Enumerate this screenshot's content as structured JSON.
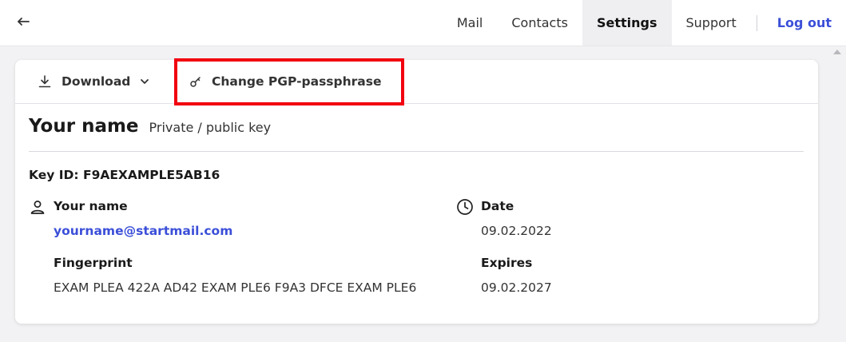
{
  "nav": {
    "back_icon": "arrow-left-icon",
    "items": [
      {
        "label": "Mail"
      },
      {
        "label": "Contacts"
      },
      {
        "label": "Settings",
        "active": true
      },
      {
        "label": "Support"
      }
    ],
    "logout": "Log out"
  },
  "toolbar": {
    "download": {
      "label": "Download",
      "icon": "download-icon"
    },
    "change_passphrase": {
      "label": "Change PGP-passphrase",
      "icon": "key-icon"
    }
  },
  "key": {
    "title": "Your name",
    "type": "Private / public key",
    "key_id": "Key ID: F9AEXAMPLE5AB16",
    "user_label": "Your name",
    "email": "yourname@startmail.com",
    "fingerprint_label": "Fingerprint",
    "fingerprint": "EXAM PLEA 422A AD42 EXAM PLE6 F9A3 DFCE EXAM PLE6",
    "date_label": "Date",
    "date": "09.02.2022",
    "expires_label": "Expires",
    "expires": "09.02.2027"
  },
  "colors": {
    "accent": "#3b4fd8",
    "highlight": "#f2000f"
  }
}
